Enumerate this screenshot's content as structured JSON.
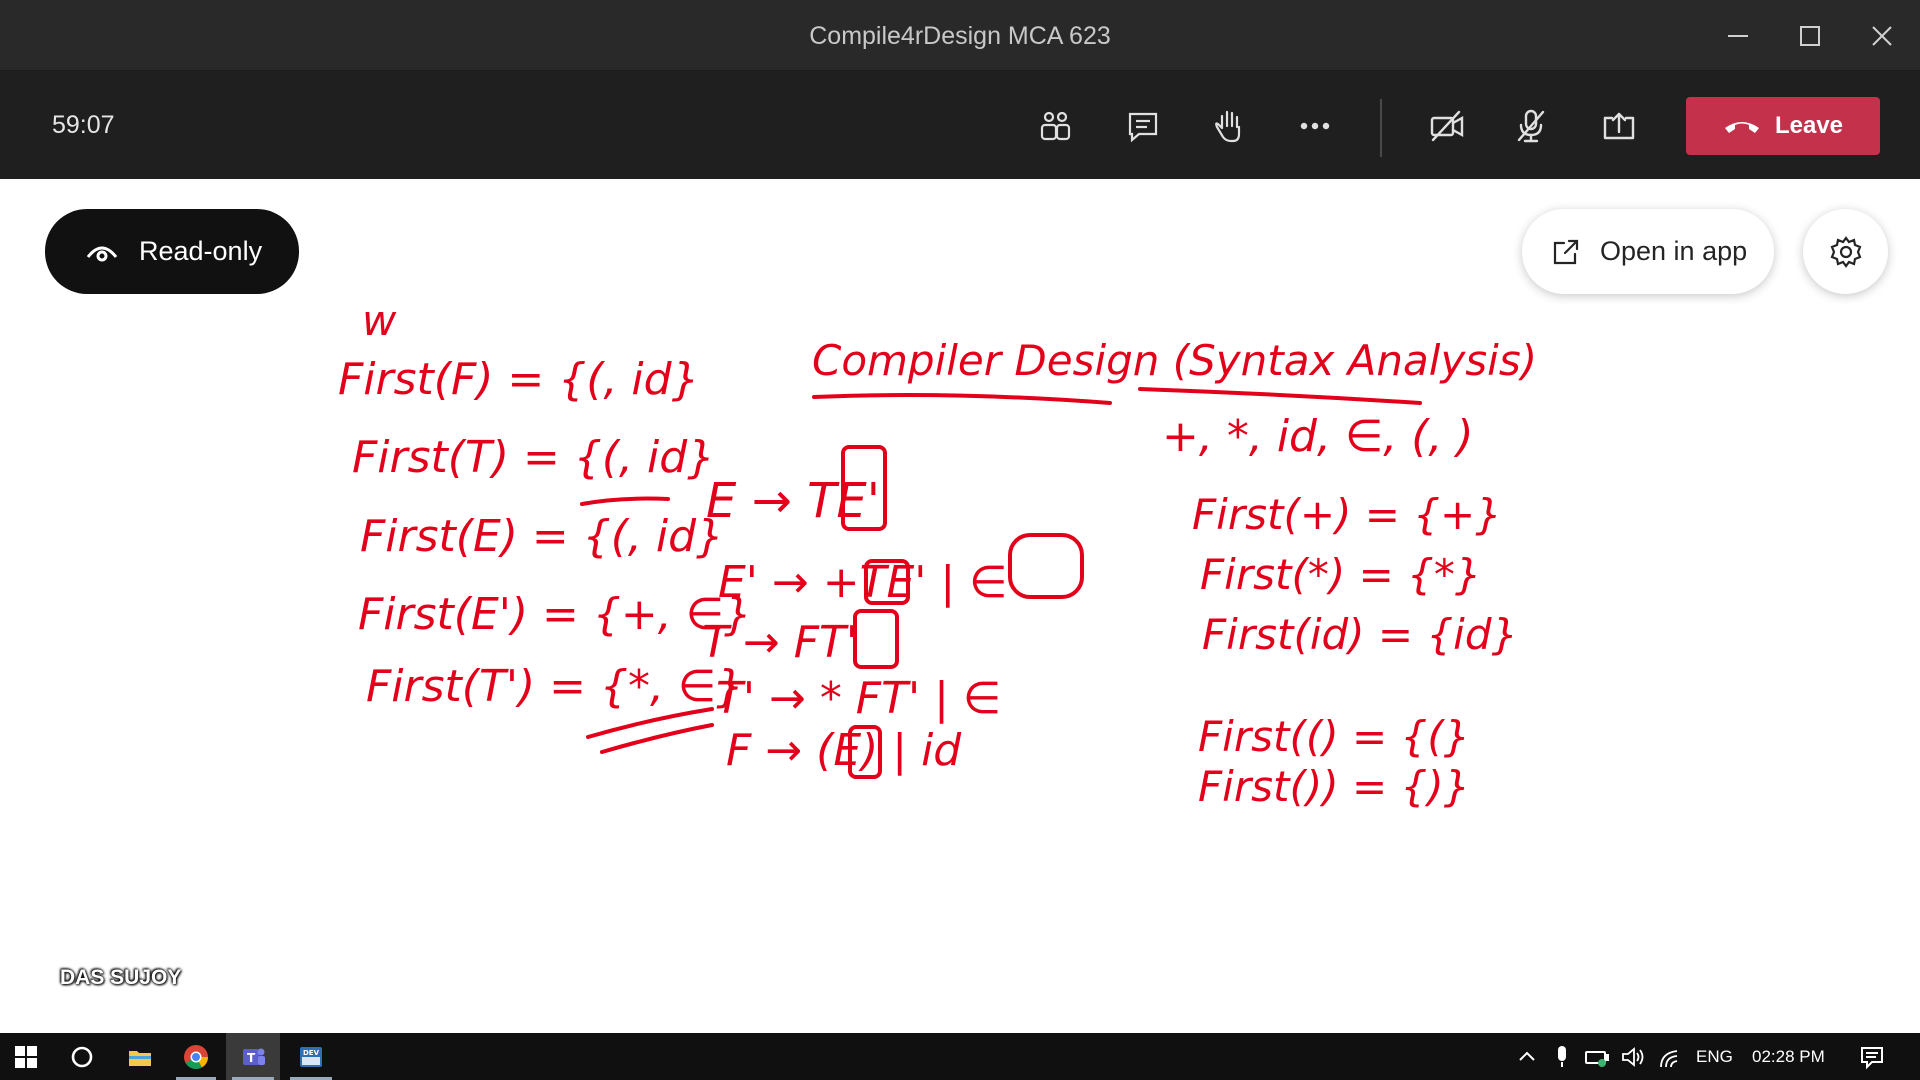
{
  "window": {
    "title": "Compile4rDesign MCA 623",
    "minimize_icon": "minimize-icon",
    "maximize_icon": "maximize-icon",
    "close_icon": "close-icon"
  },
  "meeting": {
    "timer": "59:07",
    "buttons": [
      {
        "name": "participants-button",
        "icon": "people-icon"
      },
      {
        "name": "chat-button",
        "icon": "chat-icon"
      },
      {
        "name": "raise-hand-button",
        "icon": "hand-icon"
      },
      {
        "name": "more-actions-button",
        "icon": "more-icon"
      },
      {
        "name": "camera-button",
        "icon": "camera-off-icon"
      },
      {
        "name": "mic-button",
        "icon": "mic-off-icon"
      },
      {
        "name": "share-button",
        "icon": "share-icon"
      }
    ],
    "leave_label": "Leave",
    "leave_color": "#c4314b"
  },
  "whiteboard": {
    "readonly_label": "Read-only",
    "open_in_app_label": "Open in app",
    "settings_icon": "gear-icon",
    "presenter_name": "DAS SUJOY",
    "ink_color": "#e3001b",
    "heading": "Compiler Design (Syntax Analysis)",
    "top_mark": "w",
    "first_sets_left": [
      "First(F) = {(, id}",
      "First(T) = {(, id}",
      "First(E) = {(, id}",
      "First(E') = {+, ∈}",
      "First(T') = {*, ∈}"
    ],
    "grammar": [
      "E → TE'",
      "E' → +TE' | ∈",
      "T → FT'",
      "T' → * FT' | ∈",
      "F → (E) | id"
    ],
    "terminals": "+, *, id, ∈, (, )",
    "first_sets_right": [
      "First(+) = {+}",
      "First(*) = {*}",
      "First(id) = {id}",
      "First(() = {(}",
      "First()) = {)}"
    ]
  },
  "taskbar": {
    "apps": [
      "windows-start-icon",
      "search-circle-icon",
      "file-explorer-icon",
      "chrome-icon",
      "teams-icon",
      "dev-app-icon"
    ],
    "language": "ENG",
    "time": "02:28 PM"
  }
}
